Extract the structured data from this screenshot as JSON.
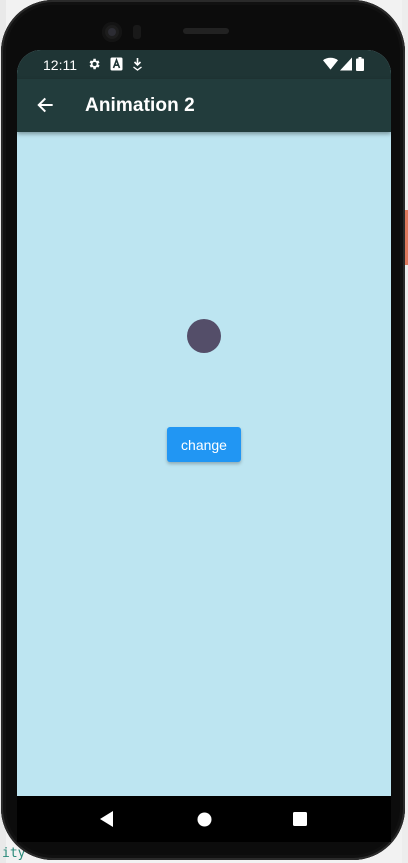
{
  "status_bar": {
    "time": "12:11",
    "icons": [
      "gear-icon",
      "a-badge-icon",
      "download-icon",
      "wifi-icon",
      "signal-icon",
      "battery-icon"
    ]
  },
  "app_bar": {
    "back_icon": "arrow-left-icon",
    "title": "Animation 2"
  },
  "content": {
    "button_label": "change"
  },
  "nav_bar": {
    "icons": [
      "nav-back-icon",
      "nav-home-icon",
      "nav-recents-icon"
    ]
  },
  "edge_text": "ity",
  "colors": {
    "status_bar_bg": "#1f3535",
    "app_bar_bg": "#223c3c",
    "body_bg": "#bde5f1",
    "ball": "#544e69",
    "button": "#2196f3"
  }
}
